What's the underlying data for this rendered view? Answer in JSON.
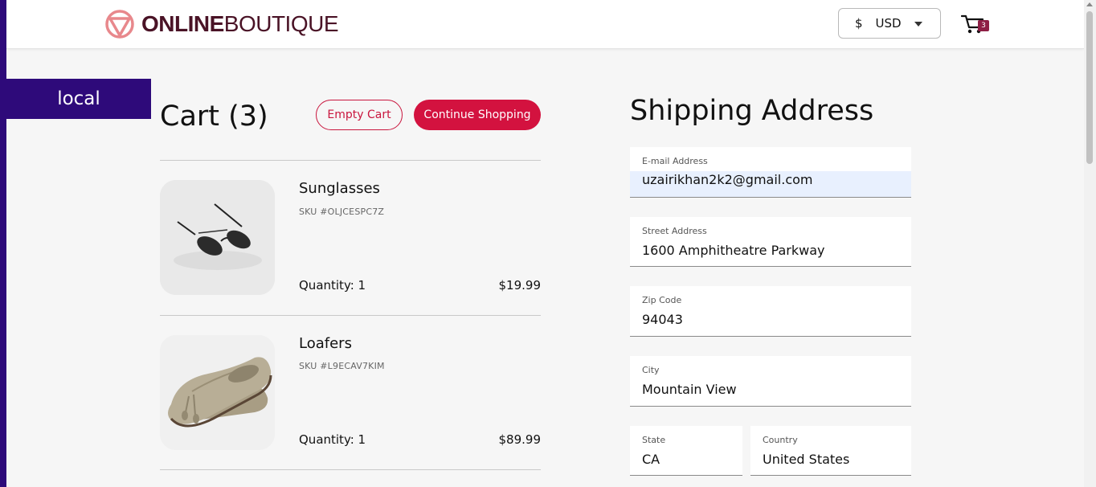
{
  "header": {
    "logo_bold": "ONLINE",
    "logo_light": "BOUTIQUE",
    "currency_symbol": "$",
    "currency_code": "USD",
    "cart_count": "3"
  },
  "env_label": "local",
  "cart": {
    "title": "Cart (3)",
    "empty_label": "Empty Cart",
    "continue_label": "Continue Shopping",
    "items": [
      {
        "name": "Sunglasses",
        "sku": "SKU #OLJCESPC7Z",
        "quantity": "Quantity: 1",
        "price": "$19.99"
      },
      {
        "name": "Loafers",
        "sku": "SKU #L9ECAV7KIM",
        "quantity": "Quantity: 1",
        "price": "$89.99"
      }
    ]
  },
  "shipping": {
    "title": "Shipping Address",
    "email_label": "E-mail Address",
    "email_value": "uzairikhan2k2@gmail.com",
    "street_label": "Street Address",
    "street_value": "1600 Amphitheatre Parkway",
    "zip_label": "Zip Code",
    "zip_value": "94043",
    "city_label": "City",
    "city_value": "Mountain View",
    "state_label": "State",
    "state_value": "CA",
    "country_label": "Country",
    "country_value": "United States"
  },
  "colors": {
    "brand_dark": "#4a1326",
    "accent_red": "#d3123f",
    "env_purple": "#2e0a7a",
    "autofill": "#e8f0fe"
  }
}
